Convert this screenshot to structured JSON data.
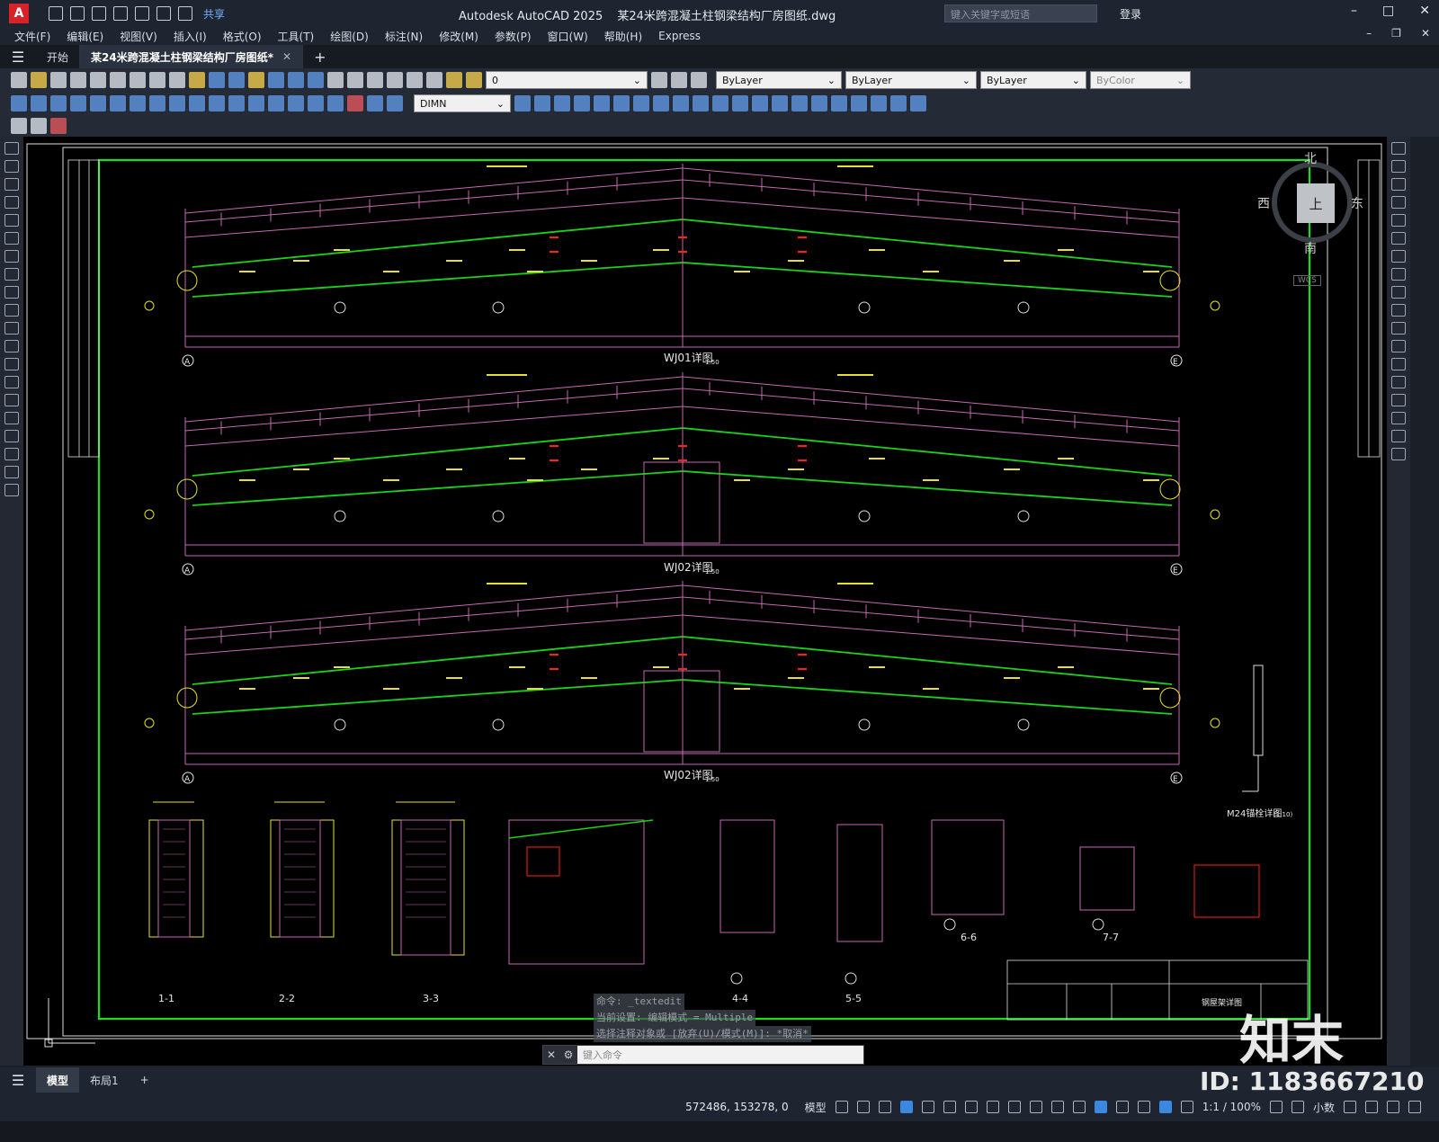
{
  "app": {
    "logo": "A",
    "title_app": "Autodesk AutoCAD 2025",
    "title_file": "某24米跨混凝土柱钢梁结构厂房图纸.dwg",
    "share": "共享",
    "search_placeholder": "键入关键字或短语",
    "login": "登录"
  },
  "menu": [
    "文件(F)",
    "编辑(E)",
    "视图(V)",
    "插入(I)",
    "格式(O)",
    "工具(T)",
    "绘图(D)",
    "标注(N)",
    "修改(M)",
    "参数(P)",
    "窗口(W)",
    "帮助(H)",
    "Express"
  ],
  "tabs": {
    "start": "开始",
    "active": "某24米跨混凝土柱钢梁结构厂房图纸*",
    "add": "+"
  },
  "toolbar": {
    "layer_value": "0",
    "color_combo": "ByLayer",
    "linetype_combo": "ByLayer",
    "lineweight_combo": "ByLayer",
    "plotstyle_combo": "ByColor",
    "dimstyle_combo": "DIMN"
  },
  "viewcube": {
    "north": "北",
    "south": "南",
    "east": "东",
    "west": "西",
    "top": "上",
    "wcs": "WCS"
  },
  "drawing": {
    "frame_titles": [
      "WJ01详图",
      "WJ02详图",
      "WJ02详图"
    ],
    "scale": "1:50",
    "axis_left": "A",
    "axis_right": "E",
    "sections": [
      "1-1",
      "2-2",
      "3-3",
      "4-4",
      "5-5",
      "6-6",
      "7-7"
    ],
    "m24_title": "M24锚栓详图",
    "m24_scale": "(1:10)",
    "titleblock_name": "钢屋架详图"
  },
  "command": {
    "history": [
      "命令: _textedit",
      "当前设置: 编辑模式 = Multiple",
      "选择注释对象或 [放弃(U)/模式(M)]: *取消*"
    ],
    "placeholder": "键入命令"
  },
  "layouts": {
    "model": "模型",
    "layout1": "布局1",
    "add": "+"
  },
  "status": {
    "coords": "572486, 153278, 0",
    "model": "模型",
    "scale": "1:1 / 100%",
    "units": "小数"
  },
  "watermark": {
    "logo": "知末",
    "id": "ID: 1183667210"
  }
}
